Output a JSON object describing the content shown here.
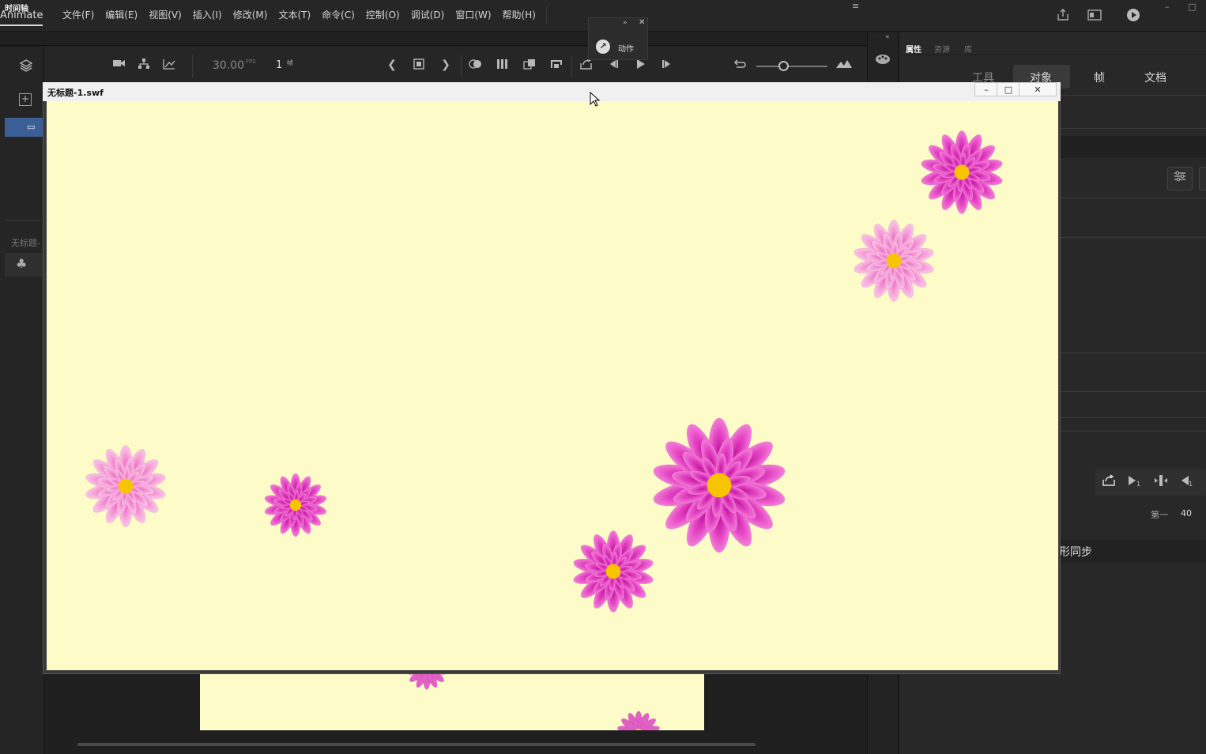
{
  "app": {
    "name": "Animate",
    "menu": [
      "文件(F)",
      "编辑(E)",
      "视图(V)",
      "插入(I)",
      "修改(M)",
      "文本(T)",
      "命令(C)",
      "控制(O)",
      "调试(D)",
      "窗口(W)",
      "帮助(H)"
    ]
  },
  "timeline": {
    "tab_label": "时间轴",
    "fps": "30.00",
    "fps_unit": "FPS",
    "frame": "1",
    "frame_unit": "帧",
    "scene_label": "无标题-"
  },
  "actions_panel": {
    "label": "动作"
  },
  "swf_window": {
    "title": "无标题-1.swf",
    "background": "#fdfcc8"
  },
  "right_panel": {
    "tabs": [
      "属性",
      "资源",
      "库"
    ],
    "subtabs": [
      "工具",
      "对象",
      "帧",
      "文档"
    ],
    "active_subtab": "对象",
    "first_label": "第一",
    "first_value": "40",
    "sync_label": "形同步"
  },
  "colors": {
    "flower_center": "#f6c400",
    "flower_petal": "#e545c4",
    "flower_petal_light": "#f7a3d6",
    "selection": "#3b5e95"
  }
}
